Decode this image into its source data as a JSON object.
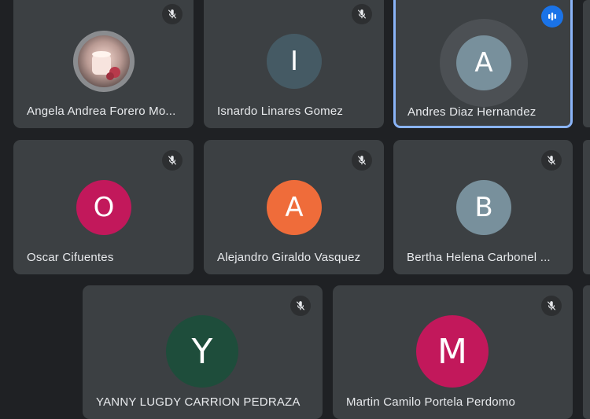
{
  "participants": [
    {
      "name": "Angela Andrea Forero Mo...",
      "initial": "",
      "avatar_type": "photo",
      "muted": true,
      "speaking": false
    },
    {
      "name": "Isnardo Linares Gomez",
      "initial": "I",
      "avatar_color": "#455a64",
      "muted": true,
      "speaking": false
    },
    {
      "name": "Andres Diaz Hernandez",
      "initial": "A",
      "avatar_color": "#78909c",
      "muted": false,
      "speaking": true
    },
    {
      "name": "Oscar Cifuentes",
      "initial": "O",
      "avatar_color": "#c2185b",
      "muted": true,
      "speaking": false
    },
    {
      "name": "Alejandro Giraldo Vasquez",
      "initial": "A",
      "avatar_color": "#ef6c3a",
      "muted": true,
      "speaking": false
    },
    {
      "name": "Bertha Helena Carbonel ...",
      "initial": "B",
      "avatar_color": "#78909c",
      "muted": true,
      "speaking": false
    },
    {
      "name": "YANNY LUGDY CARRION PEDRAZA",
      "initial": "Y",
      "avatar_color": "#1e4d3b",
      "muted": true,
      "speaking": false
    },
    {
      "name": "Martin Camilo Portela Perdomo",
      "initial": "M",
      "avatar_color": "#c2185b",
      "muted": true,
      "speaking": false
    }
  ],
  "icons": {
    "muted": "mic-off-icon",
    "speaking": "audio-level-icon"
  },
  "colors": {
    "background": "#1f2124",
    "tile": "#3c4043",
    "speaking_border": "#8ab4f8",
    "speaking_indicator": "#1a73e8"
  }
}
